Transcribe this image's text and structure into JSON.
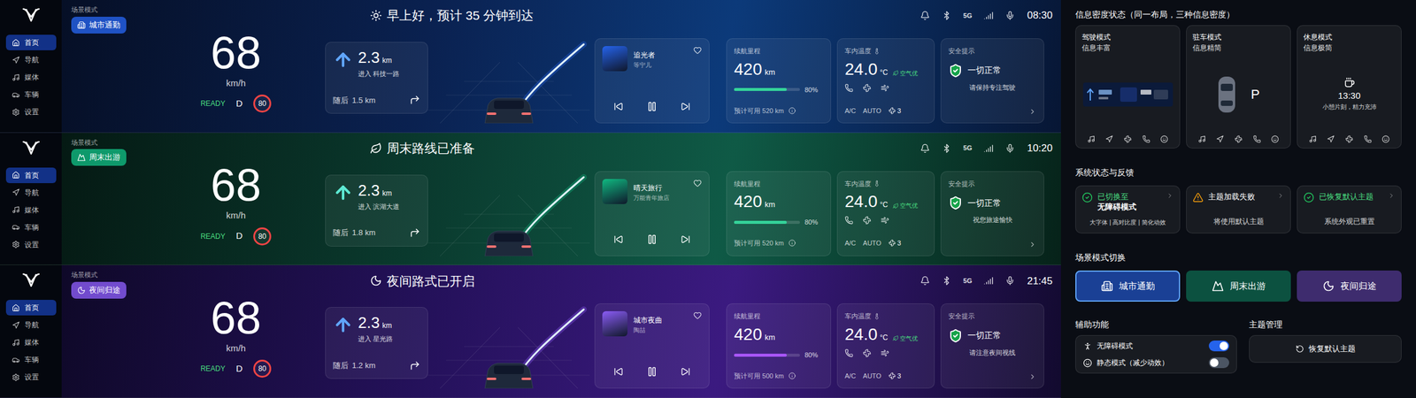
{
  "sidebar": {
    "items": [
      {
        "label": "首页",
        "selected": true
      },
      {
        "label": "导航",
        "selected": false
      },
      {
        "label": "媒体",
        "selected": false
      },
      {
        "label": "车辆",
        "selected": false
      },
      {
        "label": "设置",
        "selected": false
      }
    ]
  },
  "dashboards": [
    {
      "color": "#2563eb",
      "scene_label": "场景模式",
      "scene": "城市通勤",
      "greeting": "早上好，预计 35 分钟到达",
      "status": {
        "network": "5G",
        "time": "08:30"
      },
      "speed": "68",
      "speed_unit": "km/h",
      "ready": "READY",
      "gear": "D",
      "limit": "80",
      "nav": {
        "distance": "2.3",
        "unit": "km",
        "road": "进入 科技一路",
        "next_label": "随后",
        "next_distance": "1.5 km"
      },
      "media": {
        "title": "追光者",
        "artist": "等宁儿",
        "playing": true,
        "liked": false
      },
      "range": {
        "label": "续航里程",
        "value": "420",
        "unit": "km",
        "level": 0.8,
        "percent": "80%",
        "estimate": "预计可用 520 km",
        "color": "#34d399"
      },
      "climate": {
        "label": "车内温度",
        "value": "24.0",
        "unit": "°C",
        "air": "空气优",
        "ac": "A/C",
        "mode": "AUTO",
        "fan": "3"
      },
      "safety": {
        "label": "安全提示",
        "status": "一切正常",
        "message": "请保持专注驾驶"
      }
    },
    {
      "color": "#10b981",
      "scene_label": "场景模式",
      "scene": "周末出游",
      "greeting": "周末路线已准备",
      "status": {
        "network": "5G",
        "time": "10:20"
      },
      "speed": "68",
      "speed_unit": "km/h",
      "ready": "READY",
      "gear": "D",
      "limit": "80",
      "nav": {
        "distance": "2.3",
        "unit": "km",
        "road": "进入 滨湖大道",
        "next_label": "随后",
        "next_distance": "1.8 km"
      },
      "media": {
        "title": "晴天旅行",
        "artist": "万能青年旅店",
        "playing": true,
        "liked": false
      },
      "range": {
        "label": "续航里程",
        "value": "420",
        "unit": "km",
        "level": 0.8,
        "percent": "80%",
        "estimate": "预计可用 520 km",
        "color": "#34d399"
      },
      "climate": {
        "label": "车内温度",
        "value": "24.0",
        "unit": "°C",
        "air": "空气优",
        "ac": "A/C",
        "mode": "AUTO",
        "fan": "3"
      },
      "safety": {
        "label": "安全提示",
        "status": "一切正常",
        "message": "祝您旅途愉快"
      }
    },
    {
      "color": "#8b5cf6",
      "scene_label": "场景模式",
      "scene": "夜间归途",
      "greeting": "夜间路式已开启",
      "status": {
        "network": "5G",
        "time": "21:45"
      },
      "speed": "68",
      "speed_unit": "km/h",
      "ready": "READY",
      "gear": "D",
      "limit": "80",
      "nav": {
        "distance": "2.3",
        "unit": "km",
        "road": "进入 星光路",
        "next_label": "随后",
        "next_distance": "1.2 km"
      },
      "media": {
        "title": "城市夜曲",
        "artist": "陶喆",
        "playing": true,
        "liked": false
      },
      "range": {
        "label": "续航里程",
        "value": "420",
        "unit": "km",
        "level": 0.8,
        "percent": "80%",
        "estimate": "预计可用 500 km",
        "color": "#a855f7"
      },
      "climate": {
        "label": "车内温度",
        "value": "24.0",
        "unit": "°C",
        "air": "空气优",
        "ac": "A/C",
        "mode": "AUTO",
        "fan": "3"
      },
      "safety": {
        "label": "安全提示",
        "status": "一切正常",
        "message": "请注意夜间视线"
      }
    }
  ],
  "panel": {
    "density": {
      "title": "信息密度状态（同一布局，三种信息密度）",
      "cards": [
        {
          "kind": "driving",
          "title": "驾驶模式",
          "subtitle": "信息丰富"
        },
        {
          "kind": "parking",
          "title": "驻车模式",
          "subtitle": "信息精简",
          "gear": "P"
        },
        {
          "kind": "rest",
          "title": "休息模式",
          "subtitle": "信息极简",
          "time": "13:30",
          "message": "小憩片刻，精力充沛"
        }
      ]
    },
    "feedback": {
      "title": "系统状态与反馈",
      "items": [
        {
          "kind": "success",
          "title": "已切换至",
          "emphasis": "无障碍模式",
          "detail": "大字体 | 高对比度 | 简化动效"
        },
        {
          "kind": "warning",
          "title": "主题加载失败",
          "emphasis": "",
          "detail": "将使用默认主题"
        },
        {
          "kind": "success",
          "title": "已恢复默认主题",
          "emphasis": "",
          "detail": "系统外观已重置"
        }
      ]
    },
    "scenes": {
      "title": "场景模式切换",
      "items": [
        {
          "label": "城市通勤",
          "selected": true,
          "color": "#2563eb"
        },
        {
          "label": "周末出游",
          "selected": false,
          "color": "#10b981"
        },
        {
          "label": "夜间归途",
          "selected": false,
          "color": "#8b5cf6"
        }
      ]
    },
    "assist": {
      "title": "辅助功能",
      "items": [
        {
          "label": "无障碍模式",
          "on": true
        },
        {
          "label": "静态模式（减少动效）",
          "on": false
        }
      ]
    },
    "theme": {
      "title": "主题管理",
      "button": "恢复默认主题"
    }
  }
}
